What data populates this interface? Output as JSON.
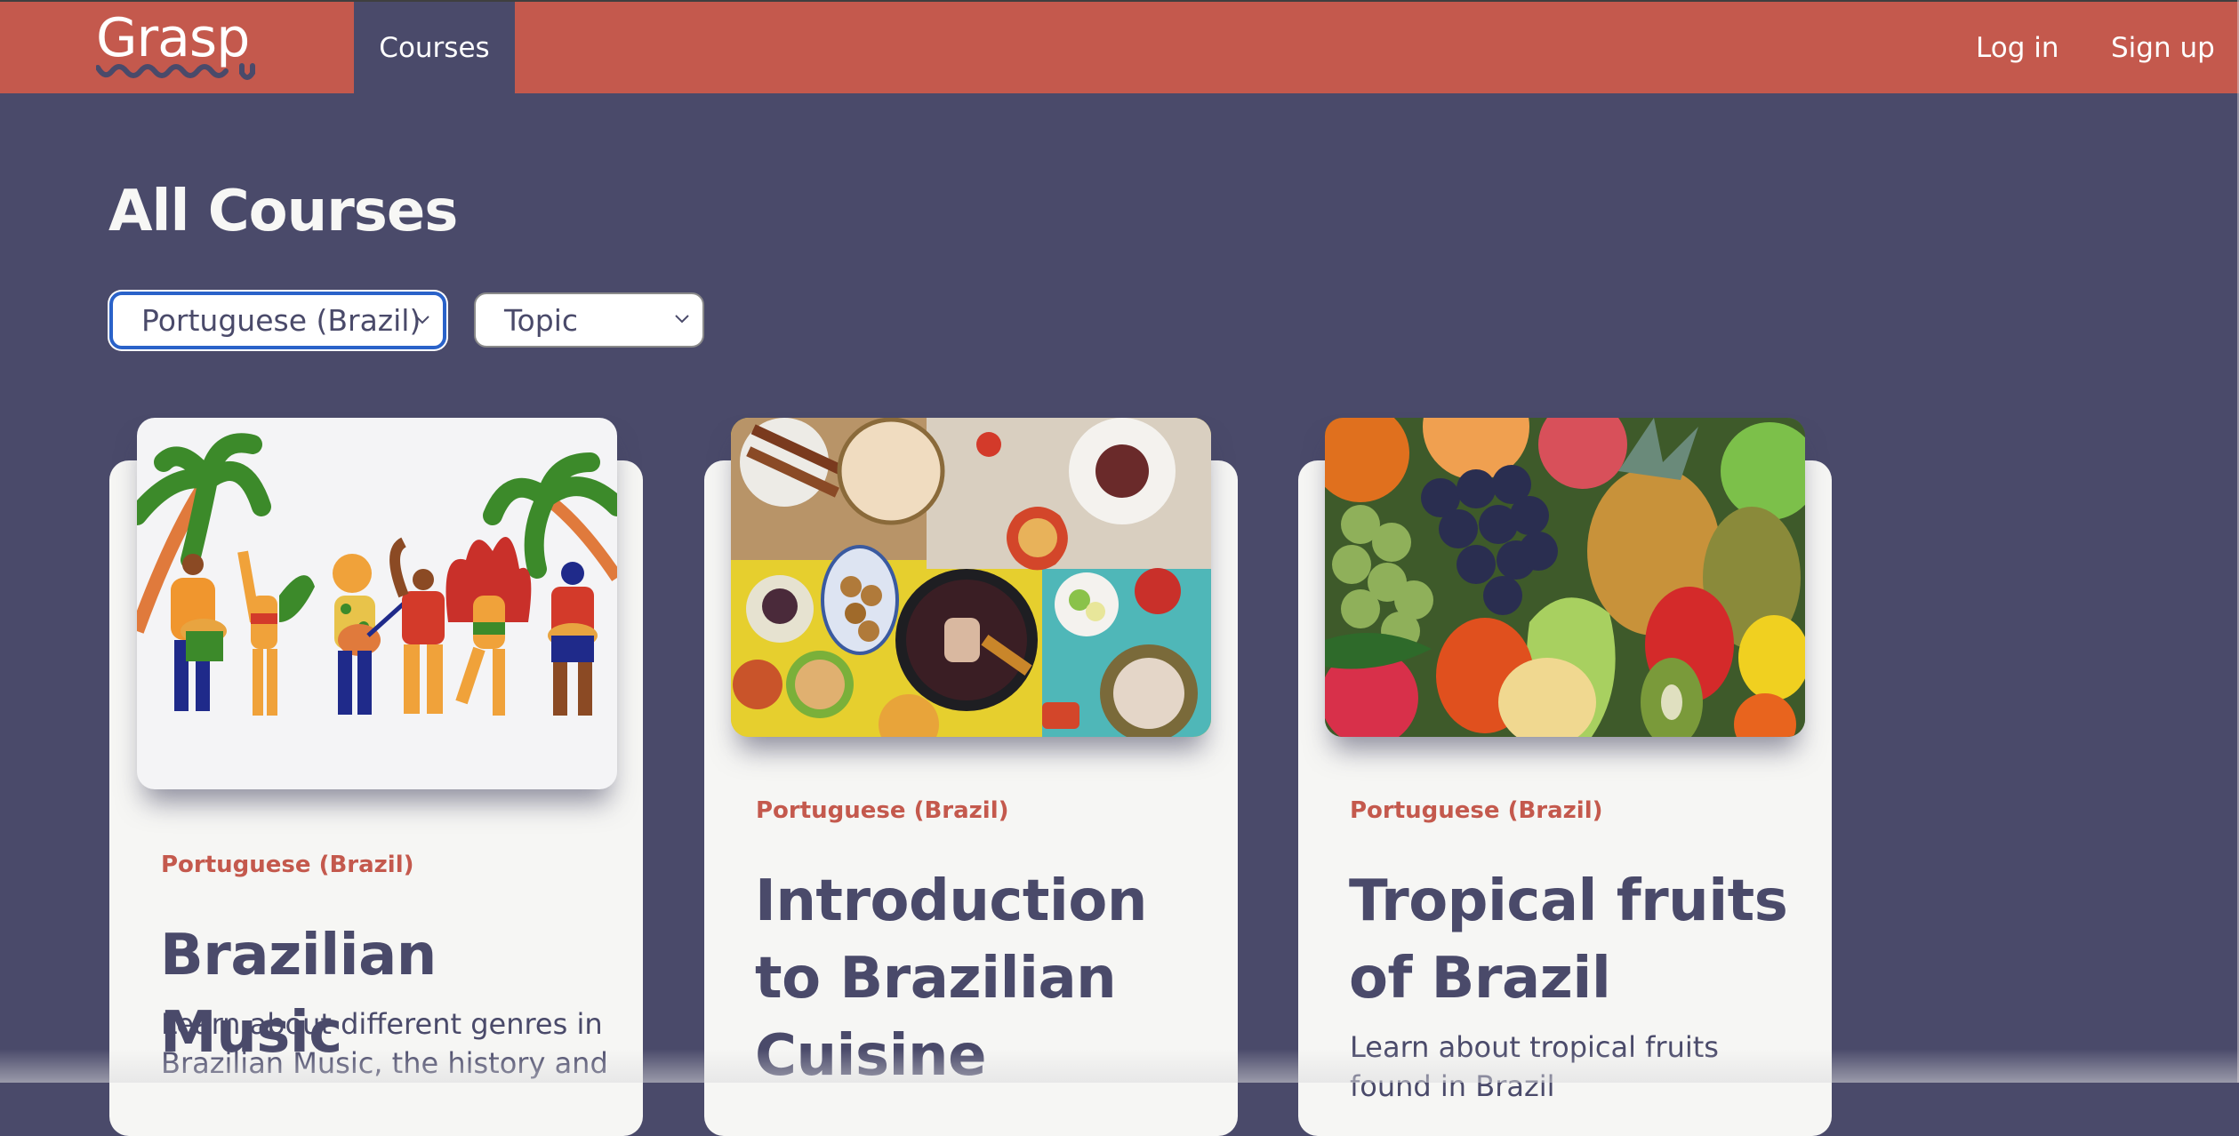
{
  "header": {
    "logo": "Grasp",
    "nav": [
      {
        "label": "Courses",
        "active": true
      }
    ],
    "login_label": "Log in",
    "signup_label": "Sign up"
  },
  "page": {
    "title": "All Courses",
    "filters": {
      "language": {
        "value": "Portuguese (Brazil)",
        "focused": true
      },
      "topic": {
        "value": "Topic"
      }
    }
  },
  "courses": [
    {
      "language": "Portuguese (Brazil)",
      "title": "Brazilian Music",
      "description": "Learn about different genres in Brazilian Music, the history and",
      "image": "brazilian-music-illustration"
    },
    {
      "language": "Portuguese (Brazil)",
      "title": "Introduction to Brazilian Cuisine",
      "description": "",
      "image": "brazilian-food-spread-photo"
    },
    {
      "language": "Portuguese (Brazil)",
      "title": "Tropical fruits of Brazil",
      "description": "Learn about tropical fruits found in Brazil",
      "image": "tropical-fruits-photo"
    }
  ],
  "colors": {
    "brand_red": "#C4594D",
    "navy": "#4A4A6A",
    "card_bg": "#F6F6F4",
    "focus_blue": "#2A62C9"
  }
}
